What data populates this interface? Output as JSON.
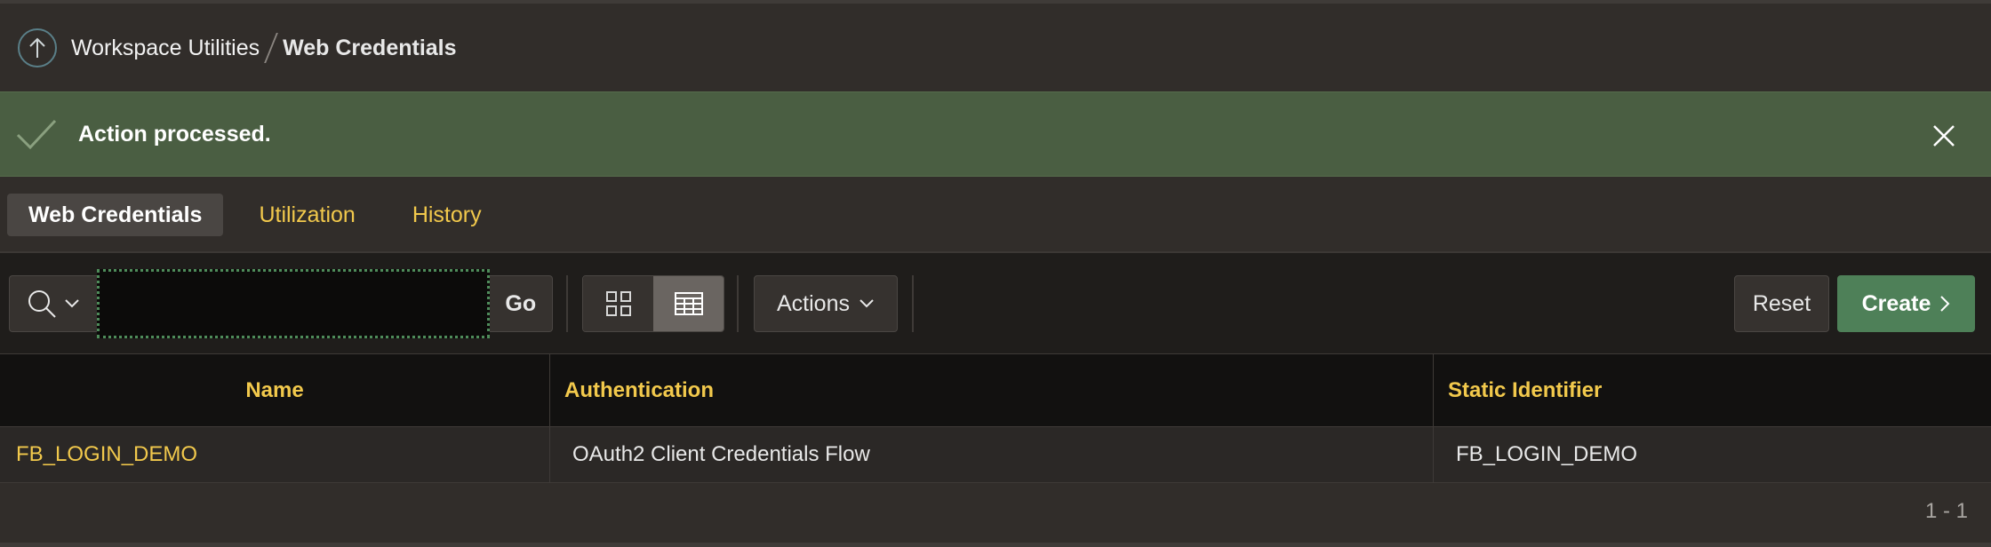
{
  "breadcrumb": {
    "parent": "Workspace Utilities",
    "current": "Web Credentials"
  },
  "alert": {
    "message": "Action processed."
  },
  "tabs": [
    {
      "label": "Web Credentials",
      "active": true
    },
    {
      "label": "Utilization",
      "active": false
    },
    {
      "label": "History",
      "active": false
    }
  ],
  "toolbar": {
    "search_value": "",
    "go_label": "Go",
    "actions_label": "Actions",
    "reset_label": "Reset",
    "create_label": "Create"
  },
  "table": {
    "columns": [
      "Name",
      "Authentication",
      "Static Identifier"
    ],
    "rows": [
      {
        "name": "FB_LOGIN_DEMO",
        "authentication": "OAuth2 Client Credentials Flow",
        "static_identifier": "FB_LOGIN_DEMO"
      }
    ]
  },
  "pagination": "1 - 1",
  "colors": {
    "background": "#312d2a",
    "success": "#4a5e42",
    "accent": "#f2c94c",
    "create_button": "#4e8058"
  }
}
